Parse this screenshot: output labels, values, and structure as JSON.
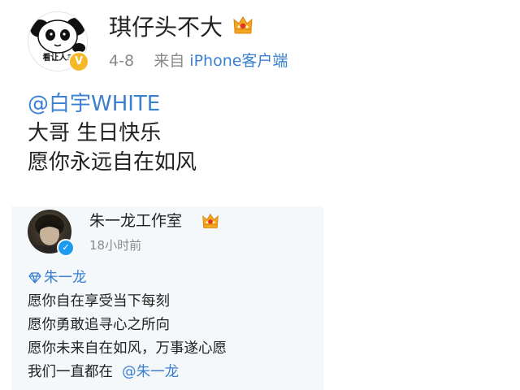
{
  "post1": {
    "username": "琪仔头不大",
    "avatar_text": "看让人3",
    "date": "4-8",
    "source_prefix": "来自",
    "source_app": "iPhone客户端",
    "mention": "@白宇WHITE",
    "lines": [
      "大哥 生日快乐",
      "愿你永远自在如风"
    ],
    "badge_color": "#f6b827",
    "link_color": "#3a7fd0"
  },
  "post2": {
    "username": "朱一龙工作室",
    "time": "18小时前",
    "tag": "朱一龙",
    "lines": [
      "愿你自在享受当下每刻",
      "愿你勇敢追寻心之所向",
      "愿你未来自在如风，万事遂心愿"
    ],
    "last_line_text": "我们一直都在",
    "last_line_mention": "@朱一龙",
    "verify_color": "#1d9bf0"
  }
}
